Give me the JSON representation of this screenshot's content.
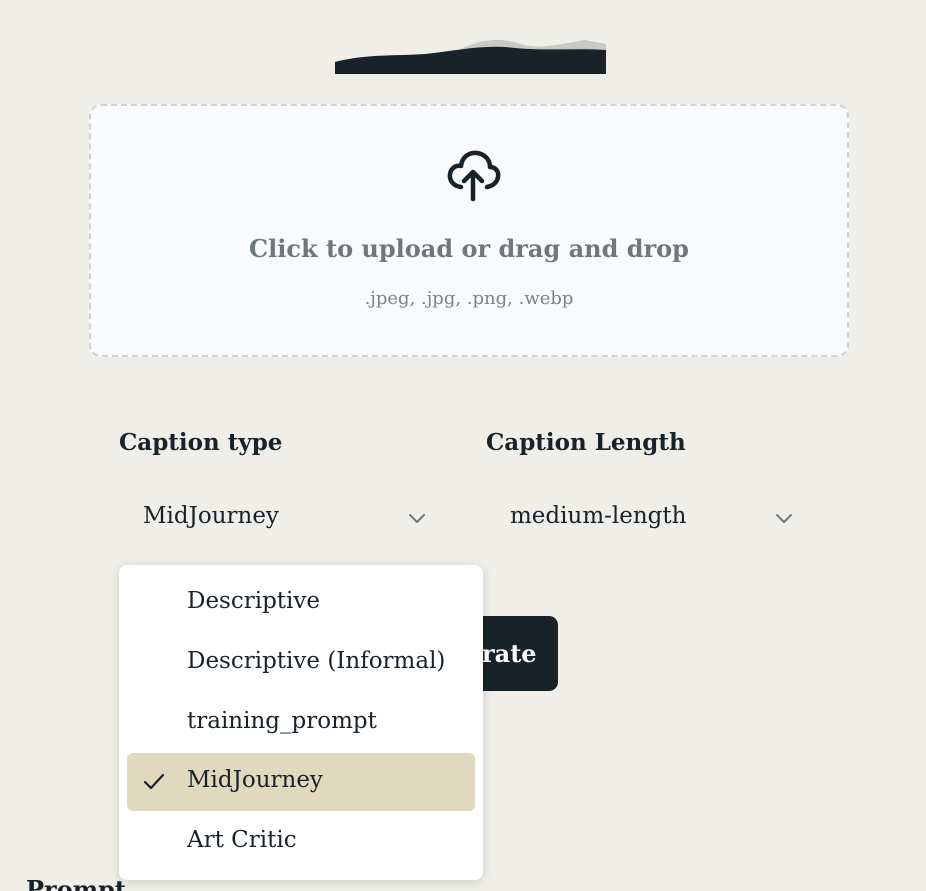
{
  "header": {
    "logo_icon": "wave-logo-icon"
  },
  "upload": {
    "icon": "cloud-upload-icon",
    "title": "Click to upload or drag and drop",
    "formats": ".jpeg, .jpg, .png, .webp"
  },
  "controls": {
    "caption_type": {
      "label": "Caption type",
      "value": "MidJourney"
    },
    "caption_length": {
      "label": "Caption Length",
      "value": "medium-length"
    },
    "generate_partial_label": "rate"
  },
  "dropdown": {
    "options": [
      {
        "label": "Descriptive",
        "selected": false
      },
      {
        "label": "Descriptive (Informal)",
        "selected": false
      },
      {
        "label": "training_prompt",
        "selected": false
      },
      {
        "label": "MidJourney",
        "selected": true
      },
      {
        "label": "Art Critic",
        "selected": false
      }
    ]
  },
  "below_fold": {
    "partial_heading": "Prompt"
  },
  "colors": {
    "background": "#efeee8",
    "primary_dark": "#172229",
    "selected_option": "#e0d9bd"
  }
}
